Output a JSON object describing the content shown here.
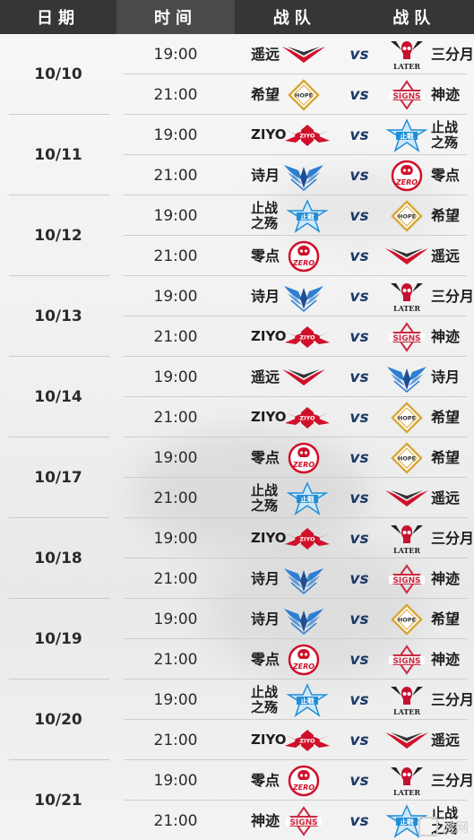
{
  "header": {
    "date": "日期",
    "time": "时间",
    "team1": "战队",
    "team2": "战队"
  },
  "vs_label": "vs",
  "watermark": "游网",
  "teams": {
    "遥远": {
      "logo": "yaoyuan-logo",
      "color": "#d0102a"
    },
    "三分月": {
      "logo": "later-logo",
      "text": "LATER",
      "color": "#c4122f"
    },
    "希望": {
      "logo": "hope-logo",
      "text": "HOPE",
      "color": "#d9a73a"
    },
    "神迹": {
      "logo": "signs-logo",
      "text": "SIGNS",
      "color": "#c92c45"
    },
    "ZIYO": {
      "logo": "ziyo-logo",
      "text": "ZIYO",
      "color": "#d0102a"
    },
    "止战之殇": {
      "logo": "zhizhan-logo",
      "text": "止戰",
      "color": "#1f8ed6"
    },
    "诗月": {
      "logo": "shiyue-logo",
      "color": "#2e7fd1"
    },
    "零点": {
      "logo": "zero-logo",
      "text": "ZERO",
      "color": "#d0102a"
    }
  },
  "schedule": [
    {
      "date": "10/10",
      "matches": [
        {
          "time": "19:00",
          "team1": "遥远",
          "team2": "三分月"
        },
        {
          "time": "21:00",
          "team1": "希望",
          "team2": "神迹"
        }
      ]
    },
    {
      "date": "10/11",
      "matches": [
        {
          "time": "19:00",
          "team1": "ZIYO",
          "team2": "止战之殇"
        },
        {
          "time": "21:00",
          "team1": "诗月",
          "team2": "零点"
        }
      ]
    },
    {
      "date": "10/12",
      "matches": [
        {
          "time": "19:00",
          "team1": "止战之殇",
          "team2": "希望"
        },
        {
          "time": "21:00",
          "team1": "零点",
          "team2": "遥远"
        }
      ]
    },
    {
      "date": "10/13",
      "matches": [
        {
          "time": "19:00",
          "team1": "诗月",
          "team2": "三分月"
        },
        {
          "time": "21:00",
          "team1": "ZIYO",
          "team2": "神迹"
        }
      ]
    },
    {
      "date": "10/14",
      "matches": [
        {
          "time": "19:00",
          "team1": "遥远",
          "team2": "诗月"
        },
        {
          "time": "21:00",
          "team1": "ZIYO",
          "team2": "希望"
        }
      ]
    },
    {
      "date": "10/17",
      "matches": [
        {
          "time": "19:00",
          "team1": "零点",
          "team2": "希望"
        },
        {
          "time": "21:00",
          "team1": "止战之殇",
          "team2": "遥远"
        }
      ]
    },
    {
      "date": "10/18",
      "matches": [
        {
          "time": "19:00",
          "team1": "ZIYO",
          "team2": "三分月"
        },
        {
          "time": "21:00",
          "team1": "诗月",
          "team2": "神迹"
        }
      ]
    },
    {
      "date": "10/19",
      "matches": [
        {
          "time": "19:00",
          "team1": "诗月",
          "team2": "希望"
        },
        {
          "time": "21:00",
          "team1": "零点",
          "team2": "神迹"
        }
      ]
    },
    {
      "date": "10/20",
      "matches": [
        {
          "time": "19:00",
          "team1": "止战之殇",
          "team2": "三分月"
        },
        {
          "time": "21:00",
          "team1": "ZIYO",
          "team2": "遥远"
        }
      ]
    },
    {
      "date": "10/21",
      "matches": [
        {
          "time": "19:00",
          "team1": "零点",
          "team2": "三分月"
        },
        {
          "time": "21:00",
          "team1": "神迹",
          "team2": "止战之殇"
        }
      ]
    }
  ]
}
